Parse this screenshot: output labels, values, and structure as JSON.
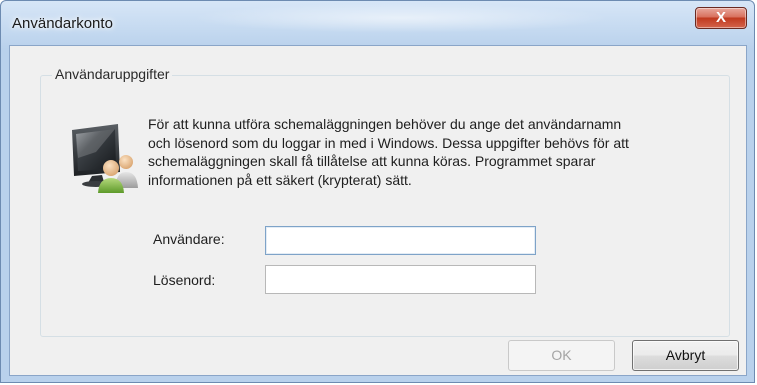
{
  "window": {
    "title": "Användarkonto",
    "close_glyph": "X"
  },
  "group": {
    "label": "Användaruppgifter",
    "icon": "user-computer-icon",
    "description_lines": [
      "För att kunna utföra schemaläggningen behöver du ange det användarnamn",
      "och lösenord som du loggar in med i Windows. Dessa uppgifter behövs för att",
      "schemaläggningen skall få tillåtelse att kunna köras. Programmet sparar",
      "informationen på ett säkert (krypterat) sätt."
    ]
  },
  "form": {
    "username_label": "Användare:",
    "username_value": "",
    "password_label": "Lösenord:",
    "password_value": ""
  },
  "buttons": {
    "ok_label": "OK",
    "ok_enabled": false,
    "cancel_label": "Avbryt"
  },
  "colors": {
    "frame": "#b9d1ec",
    "client": "#f0f0f0",
    "close_button": "#c0391f",
    "focus_border": "#7ea3c8"
  }
}
